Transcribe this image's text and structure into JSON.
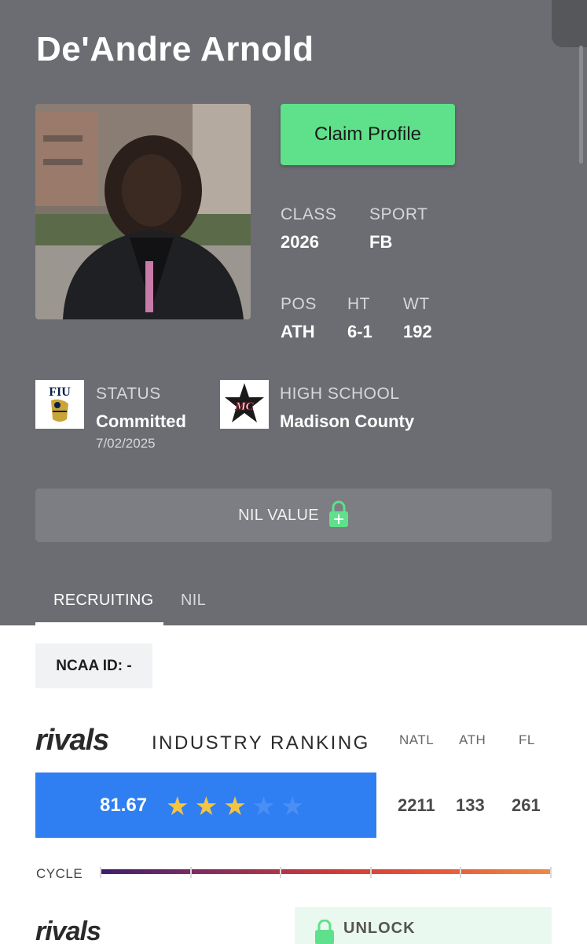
{
  "profile": {
    "name": "De'Andre Arnold",
    "claim_label": "Claim Profile",
    "class_label": "CLASS",
    "class_value": "2026",
    "sport_label": "SPORT",
    "sport_value": "FB",
    "pos_label": "POS",
    "pos_value": "ATH",
    "ht_label": "HT",
    "ht_value": "6-1",
    "wt_label": "WT",
    "wt_value": "192",
    "status_label": "STATUS",
    "status_value": "Committed",
    "status_date": "7/02/2025",
    "college_logo_text": "FIU",
    "hs_label": "HIGH SCHOOL",
    "hs_value": "Madison County",
    "hs_logo_text": "MC"
  },
  "nil": {
    "label": "NIL VALUE",
    "icon": "lock-icon"
  },
  "tabs": [
    {
      "label": "RECRUITING",
      "active": true
    },
    {
      "label": "NIL",
      "active": false
    }
  ],
  "ncaa_id": "NCAA ID:  -",
  "ranking": {
    "brand": "rivals",
    "title": "INDUSTRY RANKING",
    "score": "81.67",
    "stars": 3,
    "max_stars": 5,
    "columns": [
      {
        "label": "NATL",
        "value": "2211"
      },
      {
        "label": "ATH",
        "value": "133"
      },
      {
        "label": "FL",
        "value": "261"
      }
    ]
  },
  "cycle_label": "CYCLE",
  "second_brand": "rivals",
  "unlock_label": "UNLOCK",
  "colors": {
    "header_bg": "#6b6d72",
    "claim_green": "#5fe08a",
    "score_blue": "#2f7ff2",
    "star_gold": "#f4c443",
    "star_empty": "#4b8ff5"
  }
}
